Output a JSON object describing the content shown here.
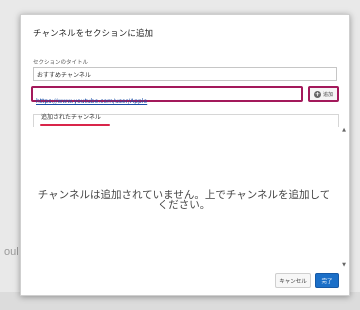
{
  "backdrop": {
    "fragment": "oul"
  },
  "dialog": {
    "title": "チャンネルをセクションに追加",
    "section_title_label": "セクションのタイトル",
    "section_title_value": "おすすめチャンネル",
    "url_value": "https://www.youtube.com/user/Apple",
    "add_button_label": "追加",
    "add_icon": "plus-circle-icon",
    "tab_label": "追加されたチャンネル",
    "empty_message": "チャンネルは追加されていません。上でチャンネルを追加してください。",
    "scroll_up_glyph": "▲",
    "scroll_down_glyph": "▼",
    "cancel_label": "キャンセル",
    "done_label": "完了"
  },
  "colors": {
    "highlight": "#a3195b",
    "tab_underline": "#d9254a",
    "primary": "#1b6fc8"
  }
}
